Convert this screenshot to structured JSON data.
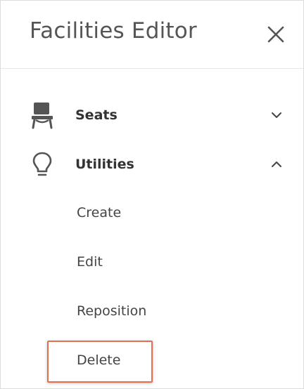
{
  "header": {
    "title": "Facilities Editor",
    "close_icon": "close-icon"
  },
  "menu": [
    {
      "label": "Seats",
      "icon": "chair-icon",
      "chevron": "chevron-down-icon",
      "expanded": false
    },
    {
      "label": "Utilities",
      "icon": "lightbulb-icon",
      "chevron": "chevron-up-icon",
      "expanded": true,
      "sub_items": [
        "Create",
        "Edit",
        "Reposition",
        "Delete"
      ]
    }
  ],
  "highlighted_item": "Delete",
  "colors": {
    "highlight_border": "#e2704f",
    "icon": "#555555",
    "text": "#333333"
  }
}
